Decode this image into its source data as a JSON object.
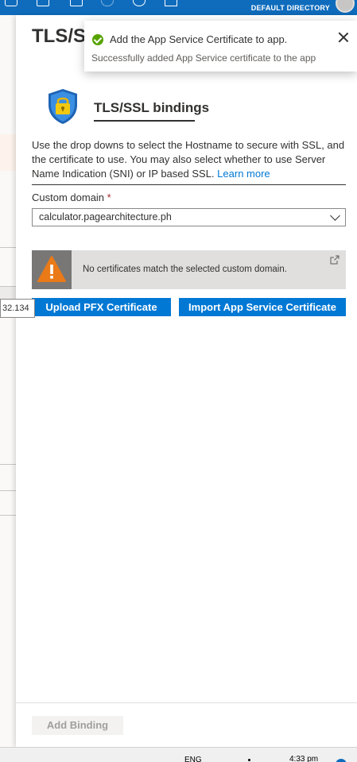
{
  "header": {
    "directory_label": "DEFAULT DIRECTORY"
  },
  "background_blade": {
    "ip_fragment": "32.134"
  },
  "panel": {
    "title": "TLS/SS"
  },
  "toast": {
    "title": "Add the App Service Certificate to app.",
    "message": "Successfully added App Service certificate to the app",
    "status_color": "#57a300"
  },
  "bindings": {
    "heading": "TLS/SSL bindings",
    "description": "Use the drop downs to select the Hostname to secure with SSL, and the certificate to use. You may also select whether to use Server Name Indication (SNI) or IP based SSL.",
    "learn_more": "Learn more",
    "custom_domain_label": "Custom domain",
    "required_marker": "*",
    "custom_domain_value": "calculator.pagearchitecture.ph",
    "warning_text": "No certificates match the selected custom domain.",
    "upload_button": "Upload PFX Certificate",
    "import_button": "Import App Service Certificate",
    "accent_color": "#0078d4"
  },
  "footer": {
    "add_binding_button": "Add Binding"
  },
  "taskbar": {
    "language": "ENG",
    "time": "4:33 pm"
  }
}
